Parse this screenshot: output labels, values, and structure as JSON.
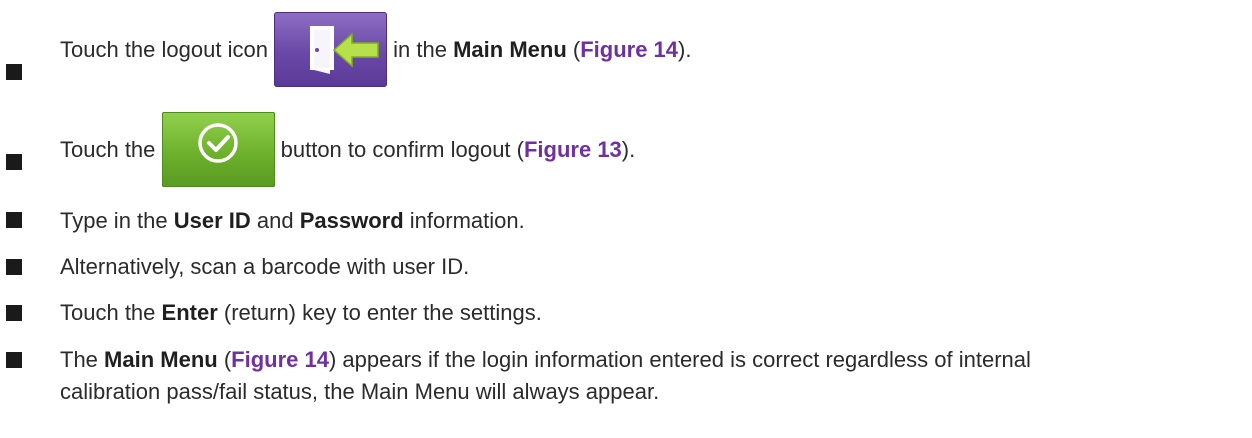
{
  "steps": [
    {
      "pre": "Touch the logout icon ",
      "icon": "logout-icon",
      "mid": " in the ",
      "bold": "Main Menu",
      "post1": " (",
      "ref": "Figure 14",
      "post2": ")."
    },
    {
      "pre": "Touch the ",
      "icon": "confirm-check-button",
      "mid": " button to confirm logout (",
      "ref": "Figure 13",
      "post": ")."
    },
    {
      "t1": "Type in the ",
      "b1": "User ID",
      "t2": " and ",
      "b2": "Password",
      "t3": " information."
    },
    {
      "text": "Alternatively, scan a barcode with user ID."
    },
    {
      "t1": "Touch the ",
      "b1": "Enter",
      "t2": " (return) key to enter the settings."
    },
    {
      "t0": "The ",
      "b1": "Main Menu",
      "t1": " (",
      "ref": "Figure 14",
      "t2": ") appears if the login information entered is correct regardless of internal",
      "line2": "calibration pass/fail status, the Main Menu will always appear."
    }
  ],
  "colors": {
    "reference": "#7030a0",
    "logout_icon": "#6a48a8",
    "confirm_button": "#6aae2a"
  }
}
